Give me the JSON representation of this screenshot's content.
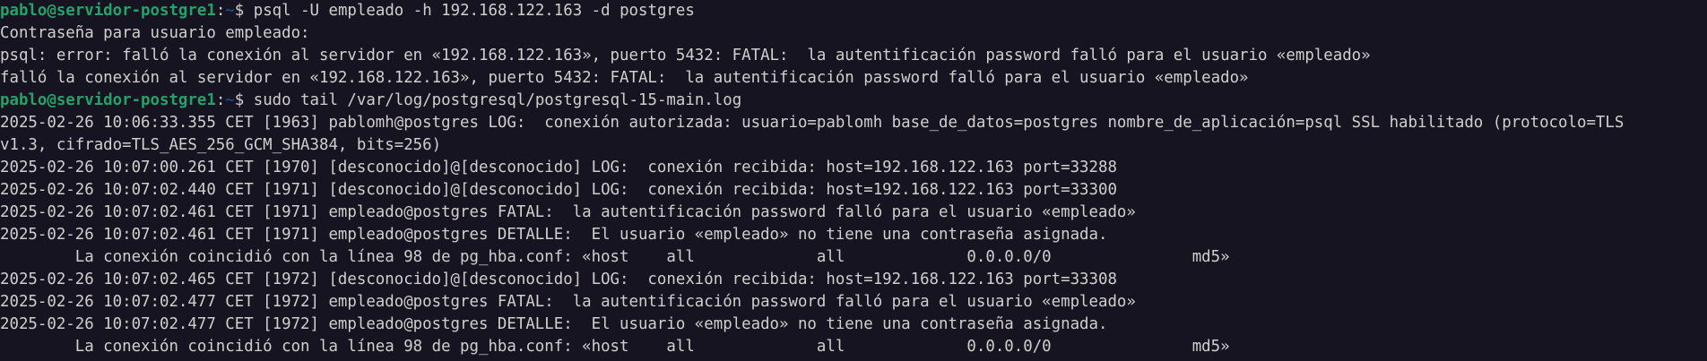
{
  "colors": {
    "background": "#171421",
    "foreground": "#d0cfcc",
    "prompt_user": "#26a269",
    "prompt_path": "#12488b"
  },
  "terminal": {
    "lines": [
      {
        "type": "prompt",
        "user": "pablo@servidor-postgre1",
        "sep": ":",
        "path": "~",
        "symbol": "$ ",
        "command": "psql -U empleado -h 192.168.122.163 -d postgres"
      },
      {
        "type": "output",
        "text": "Contraseña para usuario empleado:"
      },
      {
        "type": "output",
        "text": "psql: error: falló la conexión al servidor en «192.168.122.163», puerto 5432: FATAL:  la autentificación password falló para el usuario «empleado»"
      },
      {
        "type": "output",
        "text": "falló la conexión al servidor en «192.168.122.163», puerto 5432: FATAL:  la autentificación password falló para el usuario «empleado»"
      },
      {
        "type": "prompt",
        "user": "pablo@servidor-postgre1",
        "sep": ":",
        "path": "~",
        "symbol": "$ ",
        "command": "sudo tail /var/log/postgresql/postgresql-15-main.log"
      },
      {
        "type": "output",
        "text": "2025-02-26 10:06:33.355 CET [1963] pablomh@postgres LOG:  conexión autorizada: usuario=pablomh base_de_datos=postgres nombre_de_aplicación=psql SSL habilitado (protocolo=TLS"
      },
      {
        "type": "output",
        "text": "v1.3, cifrado=TLS_AES_256_GCM_SHA384, bits=256)"
      },
      {
        "type": "output",
        "text": "2025-02-26 10:07:00.261 CET [1970] [desconocido]@[desconocido] LOG:  conexión recibida: host=192.168.122.163 port=33288"
      },
      {
        "type": "output",
        "text": "2025-02-26 10:07:02.440 CET [1971] [desconocido]@[desconocido] LOG:  conexión recibida: host=192.168.122.163 port=33300"
      },
      {
        "type": "output",
        "text": "2025-02-26 10:07:02.461 CET [1971] empleado@postgres FATAL:  la autentificación password falló para el usuario «empleado»"
      },
      {
        "type": "output",
        "text": "2025-02-26 10:07:02.461 CET [1971] empleado@postgres DETALLE:  El usuario «empleado» no tiene una contraseña asignada."
      },
      {
        "type": "output",
        "text": "        La conexión coincidió con la línea 98 de pg_hba.conf: «host    all             all             0.0.0.0/0               md5»"
      },
      {
        "type": "output",
        "text": "2025-02-26 10:07:02.465 CET [1972] [desconocido]@[desconocido] LOG:  conexión recibida: host=192.168.122.163 port=33308"
      },
      {
        "type": "output",
        "text": "2025-02-26 10:07:02.477 CET [1972] empleado@postgres FATAL:  la autentificación password falló para el usuario «empleado»"
      },
      {
        "type": "output",
        "text": "2025-02-26 10:07:02.477 CET [1972] empleado@postgres DETALLE:  El usuario «empleado» no tiene una contraseña asignada."
      },
      {
        "type": "output",
        "text": "        La conexión coincidió con la línea 98 de pg_hba.conf: «host    all             all             0.0.0.0/0               md5»"
      }
    ]
  }
}
